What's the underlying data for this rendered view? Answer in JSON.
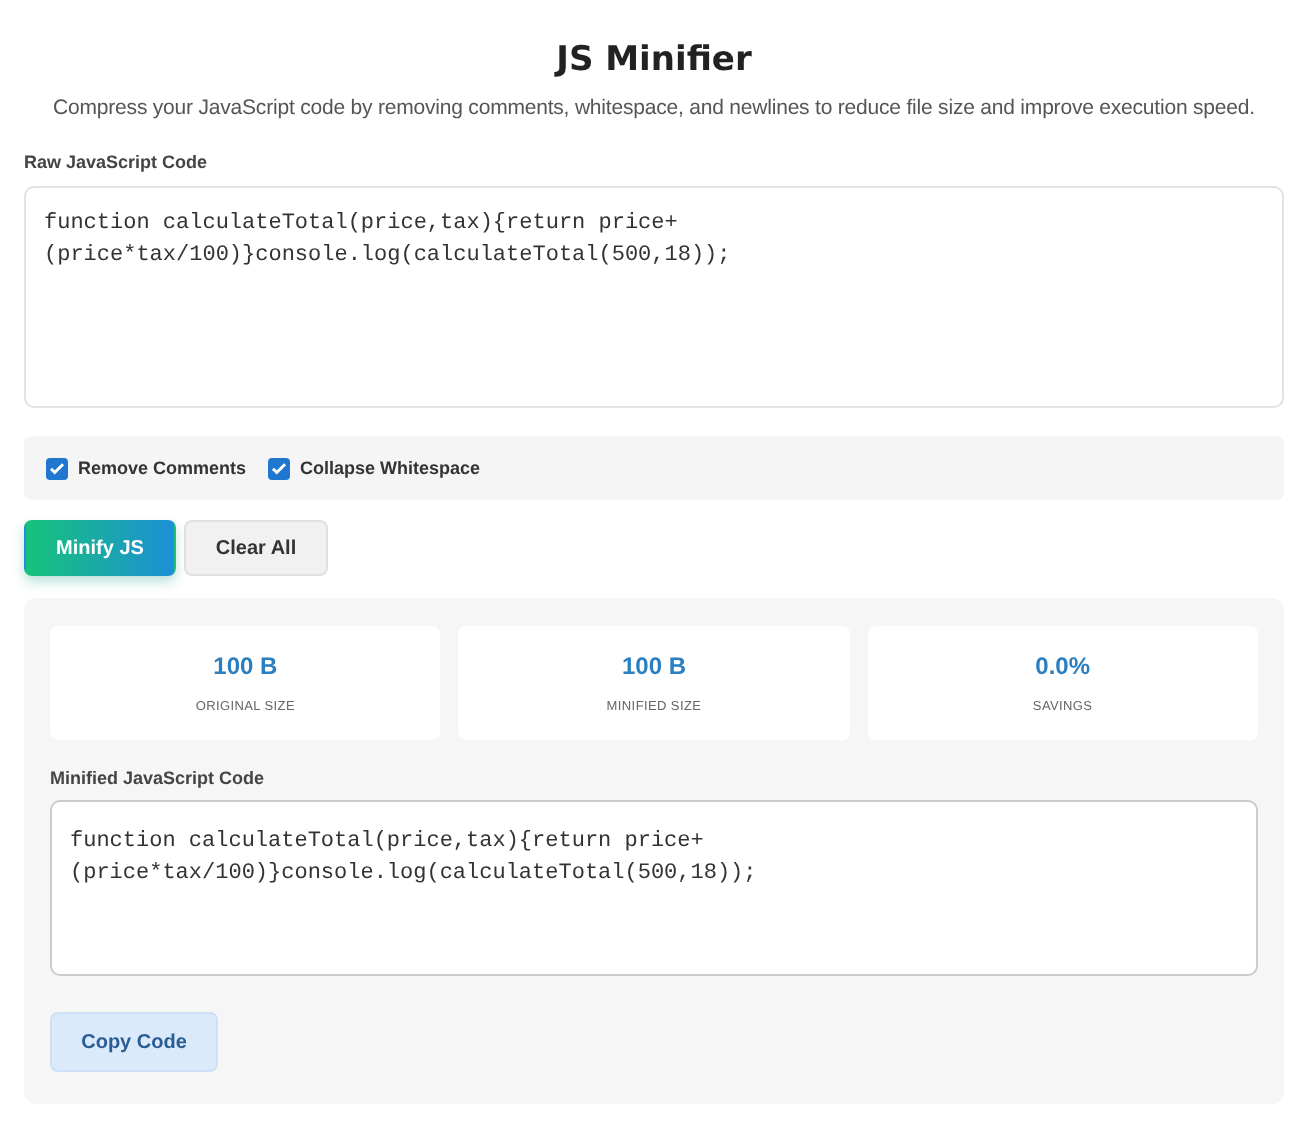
{
  "title": "JS Minifier",
  "subtitle": "Compress your JavaScript code by removing comments, whitespace, and newlines to reduce file size and improve execution speed.",
  "input": {
    "label": "Raw JavaScript Code",
    "value": "function calculateTotal(price,tax){return price+(price*tax/100)}console.log(calculateTotal(500,18));"
  },
  "options": [
    {
      "label": "Remove Comments",
      "checked": true
    },
    {
      "label": "Collapse Whitespace",
      "checked": true
    }
  ],
  "buttons": [
    {
      "label": "Minify JS",
      "kind": "primary"
    },
    {
      "label": "Clear All",
      "kind": "secondary"
    }
  ],
  "stats": [
    {
      "value": "100 B",
      "label": "ORIGINAL SIZE"
    },
    {
      "value": "100 B",
      "label": "MINIFIED SIZE"
    },
    {
      "value": "0.0%",
      "label": "SAVINGS"
    }
  ],
  "output": {
    "label": "Minified JavaScript Code",
    "value": "function calculateTotal(price,tax){return price+(price*tax/100)}console.log(calculateTotal(500,18));"
  },
  "copy_button": {
    "label": "Copy Code"
  }
}
